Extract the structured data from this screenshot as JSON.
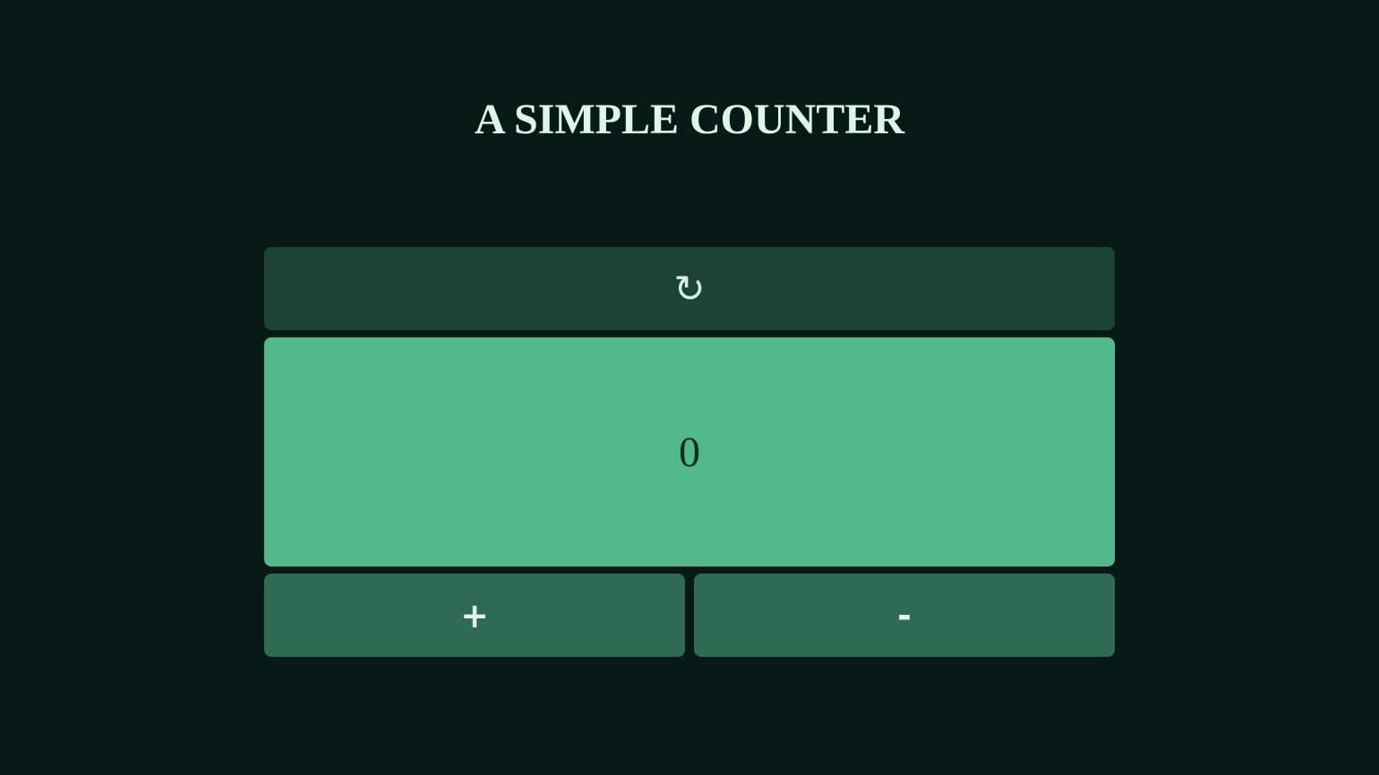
{
  "page": {
    "title": "A SIMPLE COUNTER"
  },
  "counter": {
    "reset_icon": "↻",
    "value": "0",
    "increment_label": "+",
    "decrement_label": "-"
  },
  "colors": {
    "background": "#081a16",
    "reset_button": "#1c4434",
    "display": "#52b98a",
    "step_buttons": "#2e6b52",
    "title_text": "#def6e7"
  }
}
